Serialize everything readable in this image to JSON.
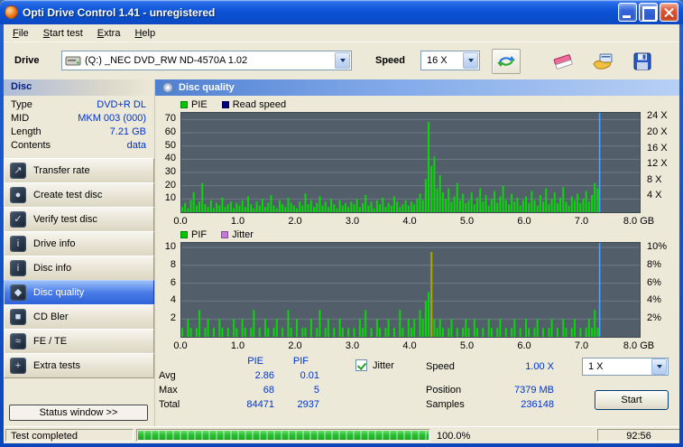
{
  "window": {
    "title": "Opti Drive Control 1.41 - unregistered"
  },
  "menu": {
    "items": [
      "File",
      "Start test",
      "Extra",
      "Help"
    ]
  },
  "toolbar": {
    "drive_label": "Drive",
    "drive_value": "(Q:) _NEC DVD_RW ND-4570A 1.02",
    "speed_label": "Speed",
    "speed_value": "16 X"
  },
  "sidebar": {
    "header": "Disc",
    "info": [
      {
        "label": "Type",
        "value": "DVD+R DL"
      },
      {
        "label": "MID",
        "value": "MKM 003 (000)"
      },
      {
        "label": "Length",
        "value": "7.21 GB"
      },
      {
        "label": "Contents",
        "value": "data"
      }
    ],
    "buttons": [
      {
        "label": "Transfer rate",
        "glyph": "↗"
      },
      {
        "label": "Create test disc",
        "glyph": "●"
      },
      {
        "label": "Verify test disc",
        "glyph": "✓"
      },
      {
        "label": "Drive info",
        "glyph": "i"
      },
      {
        "label": "Disc info",
        "glyph": "i"
      },
      {
        "label": "Disc quality",
        "glyph": "◆"
      },
      {
        "label": "CD Bler",
        "glyph": "■"
      },
      {
        "label": "FE / TE",
        "glyph": "≈"
      },
      {
        "label": "Extra tests",
        "glyph": "+"
      }
    ],
    "status_button": "Status window >>"
  },
  "main": {
    "header": "Disc quality",
    "stats": {
      "col_pie": "PIE",
      "col_pif": "PIF",
      "rows": [
        {
          "label": "Avg",
          "pie": "2.86",
          "pif": "0.01"
        },
        {
          "label": "Max",
          "pie": "68",
          "pif": "5"
        },
        {
          "label": "Total",
          "pie": "84471",
          "pif": "2937"
        }
      ]
    },
    "jitter_label": "Jitter",
    "readout": [
      {
        "label": "Speed",
        "value": "1.00 X"
      },
      {
        "label": "Position",
        "value": "7379 MB"
      },
      {
        "label": "Samples",
        "value": "236148"
      }
    ],
    "speed_select_value": "1 X",
    "start_label": "Start"
  },
  "statusbar": {
    "status": "Test completed",
    "percent": "100.0%",
    "time": "92:56"
  },
  "chart_data": [
    {
      "name": "pie-read-speed",
      "type": "bar",
      "legend": [
        {
          "label": "PIE",
          "color": "#00c800"
        },
        {
          "label": "Read speed",
          "color": "#000080"
        }
      ],
      "bg": "#525f6a",
      "grid_color": "#6e7a85",
      "bar_color": "#0ad60a",
      "y_max": 75,
      "y_ticks": [
        10,
        20,
        30,
        40,
        50,
        60,
        70
      ],
      "right_ticks": [
        {
          "label": "24 X",
          "value": 72
        },
        {
          "label": "20 X",
          "value": 60
        },
        {
          "label": "16 X",
          "value": 48
        },
        {
          "label": "12 X",
          "value": 36
        },
        {
          "label": "8 X",
          "value": 24
        },
        {
          "label": "4 X",
          "value": 12
        }
      ],
      "x_ticks": [
        "0.0",
        "1.0",
        "2.0",
        "3.0",
        "4.0",
        "5.0",
        "6.0",
        "7.0",
        "8.0 GB"
      ],
      "x_step_gb": 0.05,
      "x_max_gb": 8,
      "position_line_gb": 7.3,
      "position_line_color": "#4da6ff",
      "values": [
        4,
        7,
        3,
        9,
        15,
        5,
        8,
        22,
        6,
        4,
        9,
        3,
        7,
        5,
        11,
        4,
        6,
        8,
        3,
        7,
        5,
        9,
        4,
        12,
        6,
        3,
        8,
        5,
        10,
        4,
        7,
        13,
        5,
        3,
        9,
        6,
        4,
        11,
        7,
        5,
        3,
        8,
        5,
        14,
        6,
        9,
        4,
        7,
        12,
        5,
        8,
        4,
        10,
        6,
        3,
        9,
        5,
        7,
        4,
        8,
        6,
        10,
        4,
        7,
        13,
        5,
        8,
        3,
        9,
        6,
        11,
        4,
        7,
        5,
        12,
        8,
        4,
        6,
        9,
        5,
        8,
        6,
        10,
        14,
        9,
        25,
        68,
        35,
        42,
        18,
        28,
        15,
        10,
        18,
        8,
        12,
        22,
        9,
        14,
        7,
        9,
        15,
        6,
        11,
        18,
        8,
        13,
        5,
        10,
        16,
        7,
        12,
        20,
        9,
        6,
        14,
        8,
        11,
        5,
        9,
        12,
        7,
        16,
        9,
        5,
        13,
        8,
        18,
        6,
        10,
        15,
        7,
        11,
        19,
        8,
        5,
        12,
        9,
        14,
        7,
        10,
        16,
        8,
        13,
        22,
        18
      ],
      "spikes": []
    },
    {
      "name": "pif-jitter",
      "type": "bar",
      "legend": [
        {
          "label": "PIF",
          "color": "#00c800"
        },
        {
          "label": "Jitter",
          "color": "#c878d8"
        }
      ],
      "bg": "#525f6a",
      "grid_color": "#6e7a85",
      "bar_color": "#0ad60a",
      "y_max": 10.5,
      "y_ticks": [
        2,
        4,
        6,
        8,
        10
      ],
      "right_ticks": [
        {
          "label": "10%",
          "value": 10
        },
        {
          "label": "8%",
          "value": 8
        },
        {
          "label": "6%",
          "value": 6
        },
        {
          "label": "4%",
          "value": 4
        },
        {
          "label": "2%",
          "value": 2
        }
      ],
      "x_ticks": [
        "0.0",
        "1.0",
        "2.0",
        "3.0",
        "4.0",
        "5.0",
        "6.0",
        "7.0",
        "8.0 GB"
      ],
      "x_step_gb": 0.05,
      "x_max_gb": 8,
      "position_line_gb": 7.3,
      "position_line_color": "#4da6ff",
      "values": [
        1,
        0,
        2,
        1,
        0,
        1,
        3,
        0,
        1,
        2,
        0,
        1,
        0,
        2,
        1,
        0,
        1,
        0,
        2,
        1,
        0,
        2,
        1,
        0,
        1,
        3,
        0,
        1,
        0,
        2,
        1,
        0,
        1,
        2,
        0,
        1,
        0,
        3,
        1,
        0,
        2,
        0,
        1,
        1,
        0,
        2,
        0,
        1,
        3,
        0,
        1,
        2,
        0,
        1,
        0,
        2,
        1,
        0,
        1,
        0,
        1,
        0,
        2,
        1,
        3,
        0,
        1,
        0,
        2,
        1,
        0,
        1,
        2,
        0,
        1,
        0,
        3,
        1,
        0,
        2,
        1,
        2,
        0,
        3,
        2,
        4,
        5,
        3,
        2,
        1,
        2,
        1,
        0,
        1,
        2,
        0,
        1,
        0,
        1,
        2,
        1,
        0,
        2,
        1,
        0,
        1,
        0,
        2,
        1,
        0,
        1,
        2,
        0,
        1,
        0,
        1,
        2,
        0,
        1,
        0,
        2,
        1,
        0,
        1,
        2,
        0,
        1,
        0,
        1,
        2,
        0,
        1,
        0,
        2,
        1,
        0,
        1,
        2,
        0,
        1,
        0,
        1,
        2,
        1,
        3,
        1
      ],
      "spikes": [
        {
          "x_gb": 4.35,
          "value": 9.5,
          "color": "#a8aa00"
        }
      ]
    }
  ]
}
